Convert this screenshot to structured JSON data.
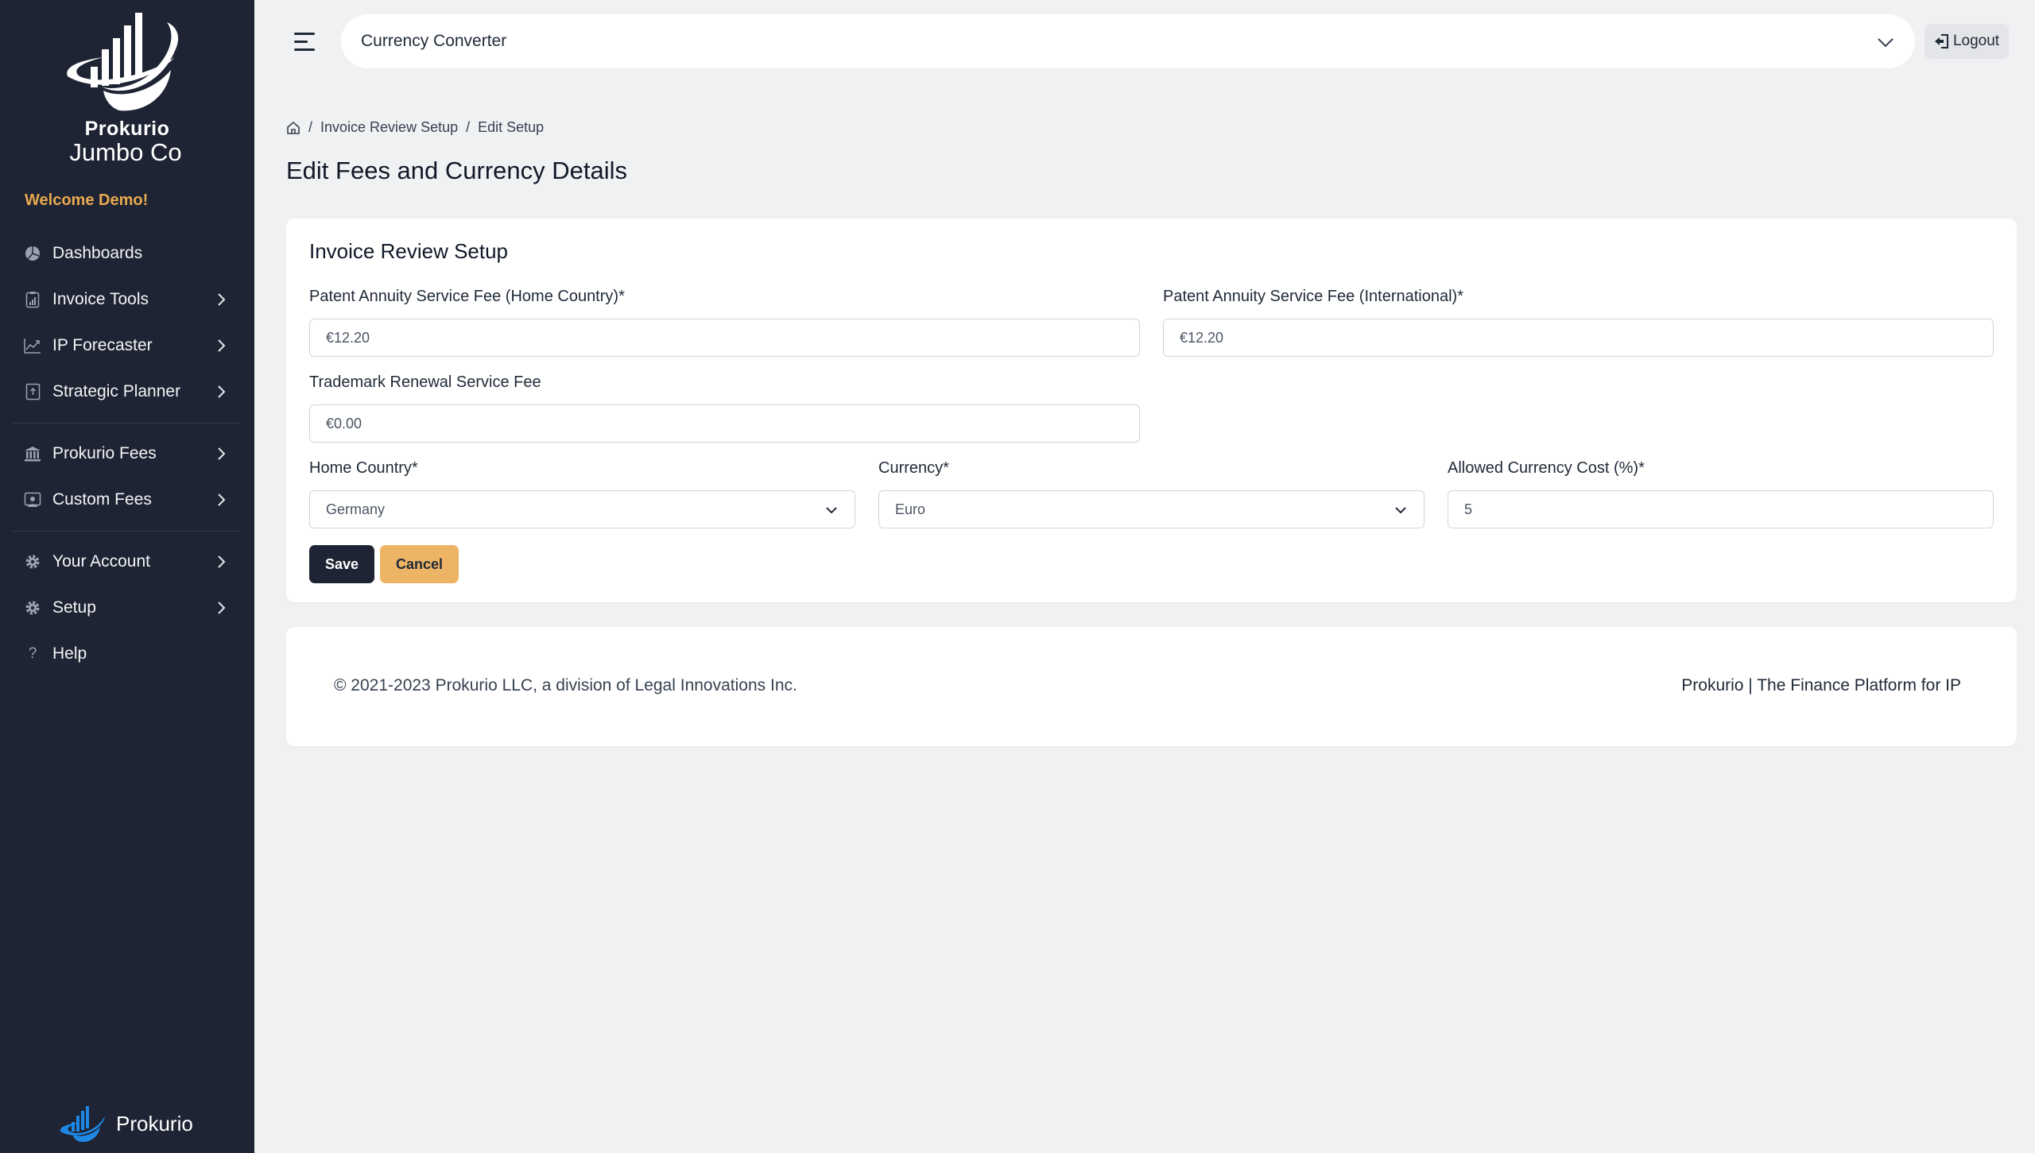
{
  "sidebar": {
    "brand_line1": "Prokurio",
    "brand_line2": "Jumbo Co",
    "welcome": "Welcome Demo!",
    "items": [
      {
        "label": "Dashboards",
        "icon": "pie-chart-icon",
        "has_submenu": false
      },
      {
        "label": "Invoice Tools",
        "icon": "clipboard-chart-icon",
        "has_submenu": true
      },
      {
        "label": "IP Forecaster",
        "icon": "trend-chart-icon",
        "has_submenu": true
      },
      {
        "label": "Strategic Planner",
        "icon": "planner-upload-icon",
        "has_submenu": true
      },
      {
        "label": "Prokurio Fees",
        "icon": "bank-icon",
        "has_submenu": true
      },
      {
        "label": "Custom Fees",
        "icon": "presentation-user-icon",
        "has_submenu": true
      },
      {
        "label": "Your Account",
        "icon": "gear-icon",
        "has_submenu": true
      },
      {
        "label": "Setup",
        "icon": "gear-icon",
        "has_submenu": true
      },
      {
        "label": "Help",
        "icon": "question-icon",
        "has_submenu": false
      }
    ],
    "bottom_brand": "Prokurio"
  },
  "topbar": {
    "selector_value": "Currency Converter",
    "logout_label": "Logout"
  },
  "breadcrumb": {
    "home_icon": "home-icon",
    "items": [
      "Invoice Review Setup",
      "Edit Setup"
    ],
    "separator": "/"
  },
  "page": {
    "title": "Edit Fees and Currency Details"
  },
  "form": {
    "card_title": "Invoice Review Setup",
    "fields": {
      "patent_home": {
        "label": "Patent Annuity Service Fee (Home Country)*",
        "value": "€12.20"
      },
      "patent_intl": {
        "label": "Patent Annuity Service Fee (International)*",
        "value": "€12.20"
      },
      "trademark": {
        "label": "Trademark Renewal Service Fee",
        "value": "€0.00"
      },
      "home_country": {
        "label": "Home Country*",
        "value": "Germany"
      },
      "currency": {
        "label": "Currency*",
        "value": "Euro"
      },
      "currency_cost": {
        "label": "Allowed Currency Cost (%)*",
        "value": "5"
      }
    },
    "save_label": "Save",
    "cancel_label": "Cancel"
  },
  "footer": {
    "copyright": "© 2021-2023 Prokurio LLC, a division of Legal Innovations Inc.",
    "tagline": "Prokurio | The Finance Platform for IP"
  },
  "colors": {
    "sidebar_bg": "#1e2433",
    "accent": "#e9a94f",
    "cancel_bg": "#eeb466",
    "page_bg": "#f0f1f3",
    "brand_blue": "#1e88e5"
  }
}
